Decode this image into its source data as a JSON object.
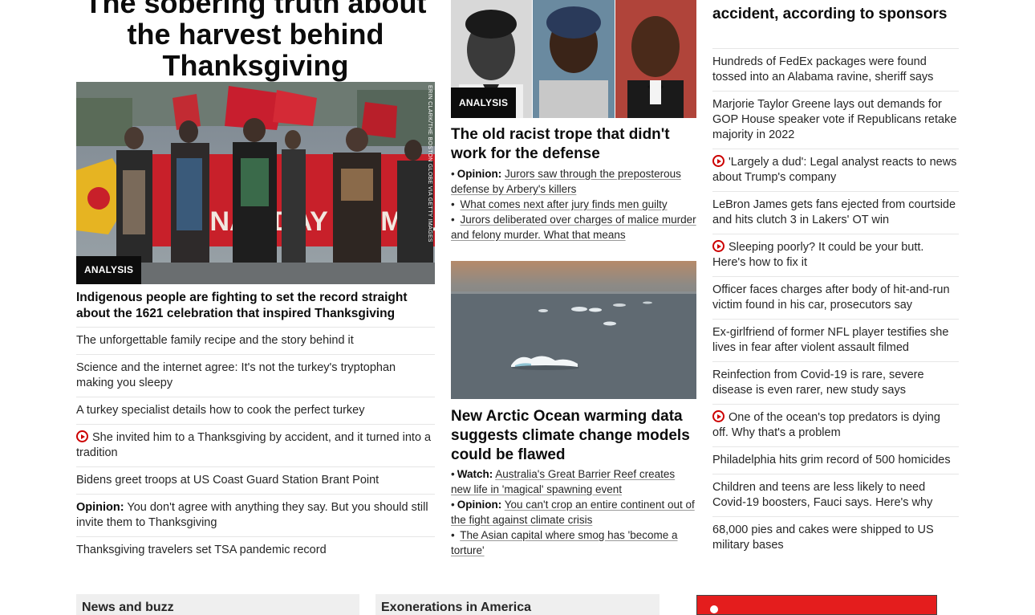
{
  "col1": {
    "headline": "The sobering truth about the harvest behind Thanksgiving",
    "photo_credit": "ERIN CLARK/THE BOSTON GLOBE VIA GETTY IMAGES",
    "photo_banner_text": "ONAL DAY OF MOURN",
    "badge": "ANALYSIS",
    "lead": "Indigenous people are fighting to set the record straight about the 1621 celebration that inspired Thanksgiving",
    "stories": [
      {
        "text": "The unforgettable family recipe and the story behind it",
        "video": false,
        "prefix": ""
      },
      {
        "text": "Science and the internet agree: It's not the turkey's tryptophan making you sleepy",
        "video": false,
        "prefix": ""
      },
      {
        "text": "A turkey specialist details how to cook the perfect turkey",
        "video": false,
        "prefix": ""
      },
      {
        "text": "She invited him to a Thanksgiving by accident, and it turned into a tradition",
        "video": true,
        "prefix": ""
      },
      {
        "text": "Bidens greet troops at US Coast Guard Station Brant Point",
        "video": false,
        "prefix": ""
      },
      {
        "text": "You don't agree with anything they say. But you should still invite them to Thanksgiving",
        "video": false,
        "prefix": "Opinion:"
      },
      {
        "text": "Thanksgiving travelers set TSA pandemic record",
        "video": false,
        "prefix": ""
      }
    ]
  },
  "col2": {
    "badge": "ANALYSIS",
    "lead1": "The old racist trope that didn't work for the defense",
    "sub1": [
      {
        "prefix": "Opinion:",
        "text": "Jurors saw through the preposterous defense by Arbery's killers"
      },
      {
        "prefix": "",
        "text": "What comes next after jury finds men guilty"
      },
      {
        "prefix": "",
        "text": "Jurors deliberated over charges of malice murder and felony murder. What that means"
      }
    ],
    "lead2": "New Arctic Ocean warming data suggests climate change models could be flawed",
    "sub2": [
      {
        "prefix": "Watch:",
        "text": "Australia's Great Barrier Reef creates new life in 'magical' spawning event"
      },
      {
        "prefix": "Opinion:",
        "text": "You can't crop an entire continent out of the fight against climate crisis"
      },
      {
        "prefix": "",
        "text": "The Asian capital where smog has 'become a torture'"
      }
    ]
  },
  "col3": {
    "top_headline": "showboater Marlo Lane dies in accident, according to sponsors",
    "stories": [
      {
        "text": "Hundreds of FedEx packages were found tossed into an Alabama ravine, sheriff says",
        "video": false
      },
      {
        "text": "Marjorie Taylor Greene lays out demands for GOP House speaker vote if Republicans retake majority in 2022",
        "video": false
      },
      {
        "text": "'Largely a dud': Legal analyst reacts to news about Trump's company",
        "video": true
      },
      {
        "text": "LeBron James gets fans ejected from courtside and hits clutch 3 in Lakers' OT win",
        "video": false
      },
      {
        "text": "Sleeping poorly? It could be your butt. Here's how to fix it",
        "video": true
      },
      {
        "text": "Officer faces charges after body of hit-and-run victim found in his car, prosecutors say",
        "video": false
      },
      {
        "text": "Ex-girlfriend of former NFL player testifies she lives in fear after violent assault filmed",
        "video": false
      },
      {
        "text": "Reinfection from Covid-19 is rare, severe disease is even rarer, new study says",
        "video": false
      },
      {
        "text": "One of the ocean's top predators is dying off. Why that's a problem",
        "video": true
      },
      {
        "text": "Philadelphia hits grim record of 500 homicides",
        "video": false
      },
      {
        "text": "Children and teens are less likely to need Covid-19 boosters, Fauci says. Here's why",
        "video": false
      },
      {
        "text": "68,000 pies and cakes were shipped to US military bases",
        "video": false
      }
    ]
  },
  "bottom": {
    "box1": "News and buzz",
    "box2": "Exonerations in America"
  },
  "colors": {
    "video_red": "#cc0000",
    "badge_bg": "#0c0c0c",
    "ad_red": "#e41d1d"
  }
}
